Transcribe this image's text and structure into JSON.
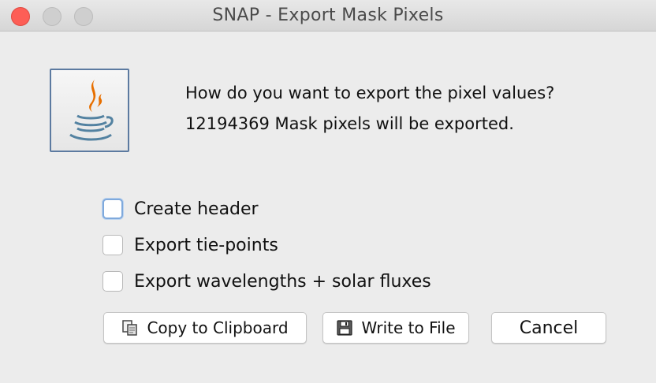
{
  "window": {
    "title": "SNAP - Export Mask Pixels"
  },
  "dialog": {
    "icon": "java-coffee-cup-icon",
    "question": "How do you want to export the pixel values?",
    "info": "12194369 Mask pixels will be exported."
  },
  "options": [
    {
      "label": "Create header",
      "checked": false,
      "focused": true
    },
    {
      "label": "Export tie-points",
      "checked": false,
      "focused": false
    },
    {
      "label": "Export wavelengths + solar fluxes",
      "checked": false,
      "focused": false
    }
  ],
  "buttons": {
    "copy": {
      "label": "Copy to Clipboard",
      "icon": "clipboard-icon"
    },
    "write": {
      "label": "Write to File",
      "icon": "floppy-disk-icon"
    },
    "cancel": {
      "label": "Cancel"
    }
  },
  "colors": {
    "close": "#fd5e56",
    "focus_ring": "#7fa9dc",
    "java_blue": "#5382a1",
    "java_orange": "#e76f00"
  }
}
